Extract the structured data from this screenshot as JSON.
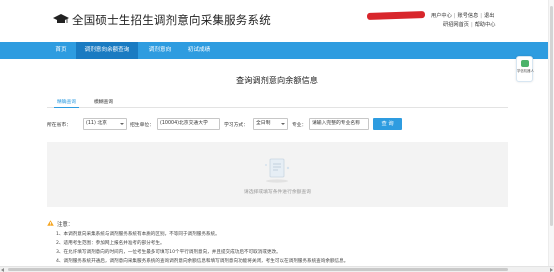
{
  "header": {
    "title": "全国硕士生招生调剂意向采集服务系统",
    "links_row1": [
      "用户中心",
      "账号信息",
      "退出"
    ],
    "links_row2": [
      "研招网首页",
      "帮助中心"
    ]
  },
  "nav": {
    "items": [
      {
        "label": "首页",
        "active": false
      },
      {
        "label": "调剂意向余额查询",
        "active": true
      },
      {
        "label": "调剂意向",
        "active": false
      },
      {
        "label": "初试成绩",
        "active": false
      }
    ]
  },
  "side_helper": {
    "label": "学信机器人"
  },
  "main": {
    "page_title": "查询调剂意向余额信息",
    "tabs": [
      {
        "label": "精确查询",
        "active": true
      },
      {
        "label": "模糊查询",
        "active": false
      }
    ],
    "filters": {
      "province_label": "所在省市：",
      "province_value": "(11) 北京",
      "unit_label": "招生单位：",
      "unit_value": "(10004)北京交通大学",
      "mode_label": "学习方式：",
      "mode_value": "全日制",
      "major_label": "专业：",
      "major_placeholder": "请输入完整的专业名称",
      "query_button": "查 询"
    },
    "empty_text": "请选择或填写条件进行余额查询"
  },
  "notes": {
    "title": "注意：",
    "lines": [
      "1、本调剂意向采集系统与调剂服务系统有本质的区别，不等同于调剂服务系统。",
      "2、适用考生范围：参加网上报名并准考的部分考生。",
      "3、在允许填写调剂意向的时间内，一位考生最多可填写10个平行调剂意向，并且提交成功后不可取消或更改。",
      "4、调剂服务系统开通后，调剂意向采集服务系统的查询调剂意向余额信息和填写调剂意向功能将关闭，考生可以在调剂服务系统查询余额信息。"
    ]
  },
  "colors": {
    "nav_bg": "#2e9ce0",
    "nav_active": "#1a7bc2",
    "accent": "#2e9ce0"
  }
}
